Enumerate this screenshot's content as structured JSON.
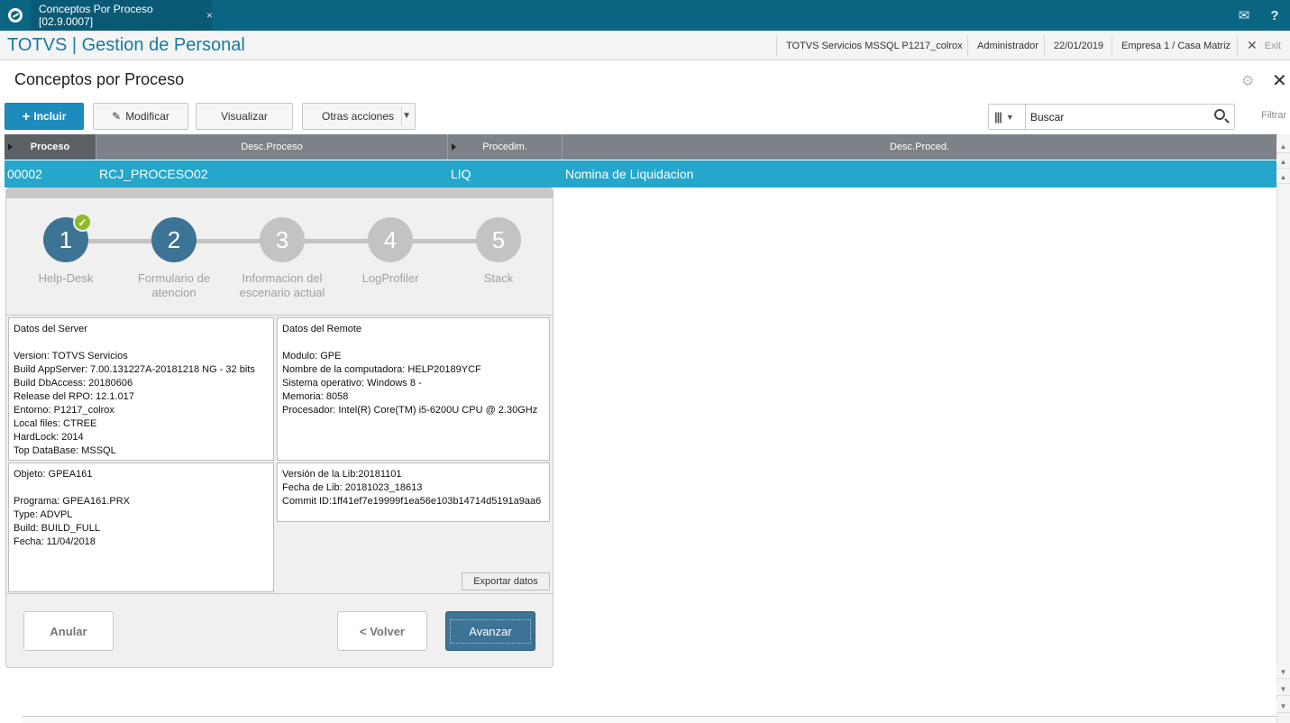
{
  "topbar": {
    "tab_title": "Conceptos Por Proceso [02.9.0007]",
    "tab_close": "×",
    "icons": [
      "totvs-logo-icon",
      "mail-icon",
      "help-icon"
    ],
    "mail_glyph": "✉",
    "help_glyph": "?"
  },
  "header": {
    "brand": "TOTVS | Gestion de Personal",
    "server": "TOTVS Servicios MSSQL P1217_colrox",
    "user": "Administrador",
    "date": "22/01/2019",
    "company": "Empresa 1 / Casa Matriz",
    "exit_x": "✕",
    "exit_label": "Exit"
  },
  "page": {
    "title": "Conceptos por Proceso",
    "gear_glyph": "⚙",
    "close_glyph": "✕"
  },
  "toolbar": {
    "incluir": "Incluir",
    "modificar": "Modificar",
    "visualizar": "Visualizar",
    "otras": "Otras acciones",
    "search_placeholder": "Buscar",
    "filtrar": "Filtrar"
  },
  "grid": {
    "columns": [
      "Proceso",
      "Desc.Proceso",
      "Procedim.",
      "Desc.Proced."
    ],
    "rows": [
      {
        "proceso": "00002",
        "desc_proceso": "RCJ_PROCESO02",
        "procedim": "LIQ",
        "desc_proced": "Nomina de Liquidacion"
      }
    ]
  },
  "wizard": {
    "steps": [
      {
        "num": "1",
        "label_lines": [
          "Help-Desk"
        ],
        "state": "done"
      },
      {
        "num": "2",
        "label_lines": [
          "Formulario de",
          "atencion"
        ],
        "state": "active"
      },
      {
        "num": "3",
        "label_lines": [
          "Informacion del",
          "escenario actual"
        ],
        "state": "pending"
      },
      {
        "num": "4",
        "label_lines": [
          "LogProfiler"
        ],
        "state": "pending"
      },
      {
        "num": "5",
        "label_lines": [
          "Stack"
        ],
        "state": "pending"
      }
    ],
    "check_glyph": "✓",
    "server_panel": {
      "title": "Datos del Server",
      "lines": [
        "Version: TOTVS Servicios",
        "Build AppServer: 7.00.131227A-20181218 NG - 32 bits",
        "Build DbAccess: 20180606",
        "Release del RPO:  12.1.017",
        "Entorno: P1217_colrox",
        "Local files: CTREE",
        "HardLock: 2014",
        "Top DataBase: MSSQL"
      ]
    },
    "remote_panel": {
      "title": "Datos del Remote",
      "lines": [
        "Modulo: GPE",
        "Nombre de la computadora: HELP20189YCF",
        "Sistema operativo: Windows 8 -",
        "Memoria: 8058",
        "Procesador: Intel(R) Core(TM) i5-6200U CPU @ 2.30GHz"
      ]
    },
    "object_panel": {
      "title": "Objeto: GPEA161",
      "lines": [
        "Programa: GPEA161.PRX",
        "Type: ADVPL",
        "Build: BUILD_FULL",
        "Fecha: 11/04/2018"
      ]
    },
    "lib_panel": {
      "lines": [
        "Versión de la Lib:20181101",
        "Fecha de Lib: 20181023_18613",
        "Commit ID:1ff41ef7e19999f1ea56e103b14714d5191a9aa6"
      ]
    },
    "export_label": "Exportar datos",
    "anular": "Anular",
    "volver": "< Volver",
    "avanzar": "Avanzar"
  }
}
